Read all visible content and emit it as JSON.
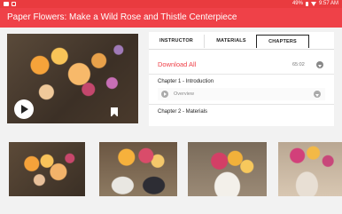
{
  "status_bar": {
    "battery": "49%",
    "time": "9:57 AM",
    "icons": [
      "photo-icon",
      "notification-icon",
      "wifi-icon",
      "battery-icon"
    ]
  },
  "header": {
    "title": "Paper Flowers: Make a Wild Rose and Thistle Centerpiece"
  },
  "tabs": [
    {
      "label": "INSTRUCTOR",
      "active": false
    },
    {
      "label": "MATERIALS",
      "active": false
    },
    {
      "label": "CHAPTERS",
      "active": true
    }
  ],
  "chapters_panel": {
    "download_all_label": "Download All",
    "total_duration": "65:02",
    "chapters": [
      {
        "title": "Chapter 1 - Introduction",
        "lessons": [
          {
            "title": "Overview"
          }
        ]
      },
      {
        "title": "Chapter 2 - Materials",
        "lessons": []
      }
    ]
  },
  "colors": {
    "accent": "#ef4148",
    "status_bar": "#e93b3f",
    "background": "#f2f2f2"
  }
}
